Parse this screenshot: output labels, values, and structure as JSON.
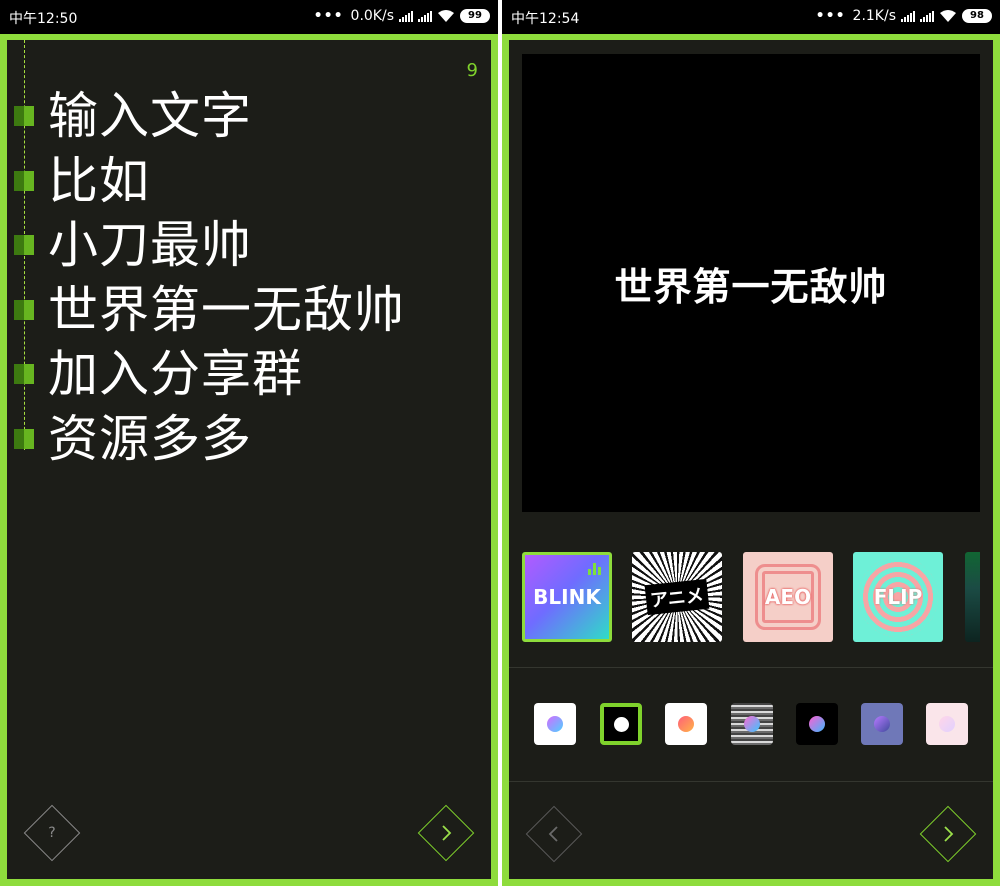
{
  "left_screen": {
    "status": {
      "time": "中午12:50",
      "speed": "0.0K/s",
      "battery": "99"
    },
    "line_counter": "9",
    "lines": [
      "输入文字",
      "比如",
      "小刀最帅",
      "世界第一无敌帅",
      "加入分享群",
      "资源多多"
    ],
    "help_symbol": "?",
    "accent_color": "#8edc3c"
  },
  "right_screen": {
    "status": {
      "time": "中午12:54",
      "speed": "2.1K/s",
      "battery": "98"
    },
    "preview_text": "世界第一无敌帅",
    "effects": [
      {
        "label": "BLINK",
        "selected": true
      },
      {
        "label": "アニメ",
        "selected": false
      },
      {
        "label": "AEO",
        "selected": false
      },
      {
        "label": "FLIP",
        "selected": false
      }
    ],
    "color_swatches": [
      {
        "name": "gradient-on-white"
      },
      {
        "name": "white-on-black",
        "selected": true
      },
      {
        "name": "warm-on-white"
      },
      {
        "name": "glitch"
      },
      {
        "name": "gradient-on-black"
      },
      {
        "name": "violet"
      },
      {
        "name": "pastel-pink"
      }
    ]
  }
}
